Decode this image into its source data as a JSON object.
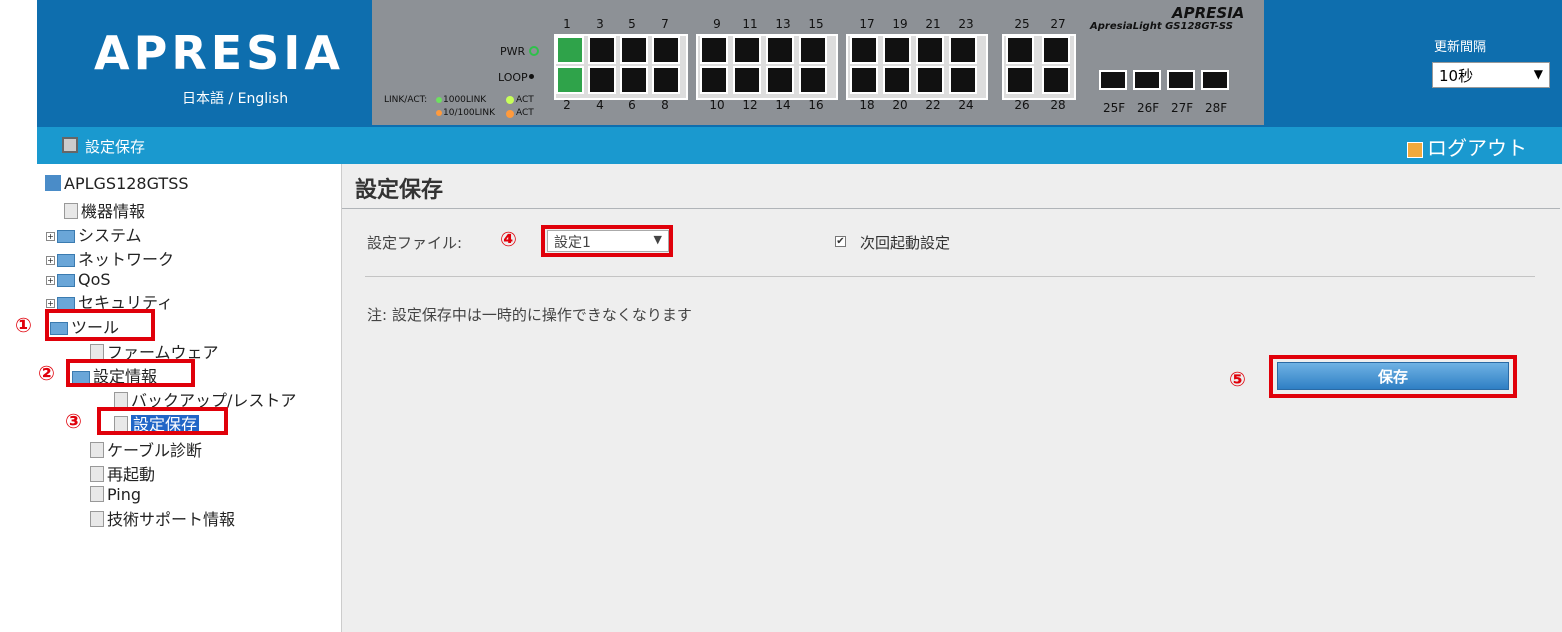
{
  "header": {
    "logo_text": "APRESIA",
    "language_links": "日本語 / English",
    "panel": {
      "brand": "APRESIA",
      "model": "ApresiaLight GS128GT-SS",
      "pwr_label": "PWR",
      "loop_label": "LOOP",
      "linkact_label": "LINK/ACT:",
      "link1000_label": "1000LINK",
      "link100_label": "10/100LINK",
      "act1_label": "ACT",
      "act2_label": "ACT",
      "top_ports": [
        "1",
        "3",
        "5",
        "7",
        "9",
        "11",
        "13",
        "15",
        "17",
        "19",
        "21",
        "23",
        "25",
        "27"
      ],
      "bottom_ports": [
        "2",
        "4",
        "6",
        "8",
        "10",
        "12",
        "14",
        "16",
        "18",
        "20",
        "22",
        "24",
        "26",
        "28"
      ],
      "sfp_ports": [
        "25F",
        "26F",
        "27F",
        "28F"
      ]
    },
    "refresh": {
      "label": "更新間隔",
      "value": "10秒"
    }
  },
  "toolbar": {
    "page_name": "設定保存",
    "logout_label": "ログアウト"
  },
  "sidebar": {
    "device": "APLGS128GTSS",
    "items": [
      {
        "label": "機器情報"
      },
      {
        "label": "システム"
      },
      {
        "label": "ネットワーク"
      },
      {
        "label": "QoS"
      },
      {
        "label": "セキュリティ"
      },
      {
        "label": "ツール"
      },
      {
        "label": "ファームウェア"
      },
      {
        "label": "設定情報"
      },
      {
        "label": "バックアップ/レストア"
      },
      {
        "label": "設定保存"
      },
      {
        "label": "ケーブル診断"
      },
      {
        "label": "再起動"
      },
      {
        "label": "Ping"
      },
      {
        "label": "技術サポート情報"
      }
    ]
  },
  "annotations": [
    "①",
    "②",
    "③",
    "④",
    "⑤"
  ],
  "main": {
    "title": "設定保存",
    "file_label": "設定ファイル:",
    "file_value": "設定1",
    "nextboot_label": "次回起動設定",
    "nextboot_checked": true,
    "note": "注: 設定保存中は一時的に操作できなくなります",
    "save_button": "保存"
  }
}
